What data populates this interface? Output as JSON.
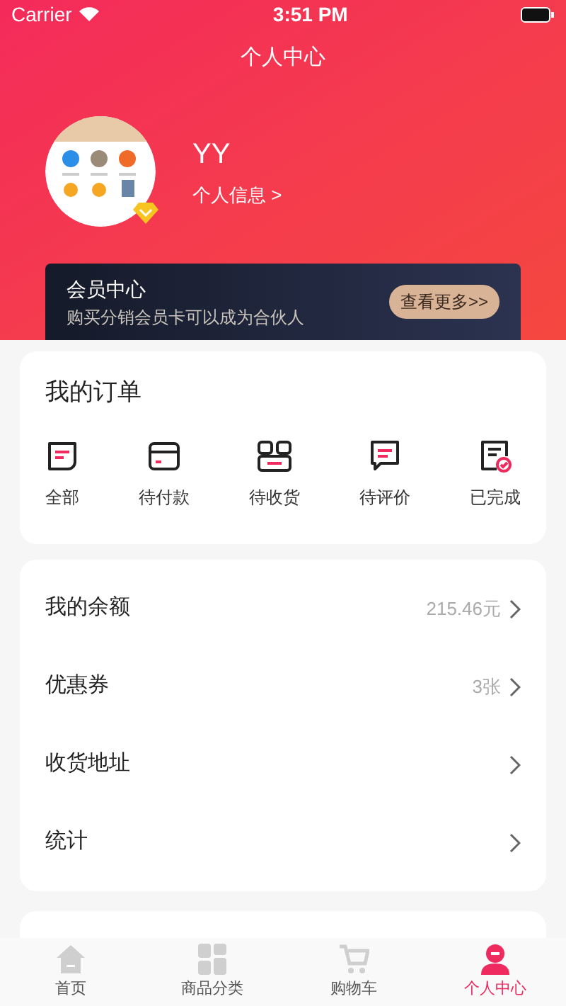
{
  "status_bar": {
    "carrier": "Carrier",
    "time": "3:51 PM"
  },
  "header": {
    "title": "个人中心"
  },
  "profile": {
    "name": "YY",
    "link": "个人信息 >"
  },
  "vip": {
    "title": "会员中心",
    "subtitle": "购买分销会员卡可以成为合伙人",
    "button": "查看更多>>"
  },
  "orders": {
    "title": "我的订单",
    "items": [
      {
        "kind": "all",
        "label": "全部"
      },
      {
        "kind": "pay",
        "label": "待付款"
      },
      {
        "kind": "receive",
        "label": "待收货"
      },
      {
        "kind": "review",
        "label": "待评价"
      },
      {
        "kind": "done",
        "label": "已完成"
      }
    ]
  },
  "menu": [
    {
      "label": "我的余额",
      "value": "215.46元"
    },
    {
      "label": "优惠券",
      "value": "3张"
    },
    {
      "label": "收货地址"
    },
    {
      "label": "统计"
    }
  ],
  "tab_bar": [
    {
      "kind": "home",
      "label": "首页",
      "selected": false
    },
    {
      "kind": "category",
      "label": "商品分类",
      "selected": false
    },
    {
      "kind": "cart",
      "label": "购物车",
      "selected": false
    },
    {
      "kind": "profile",
      "label": "个人中心",
      "selected": true
    }
  ]
}
